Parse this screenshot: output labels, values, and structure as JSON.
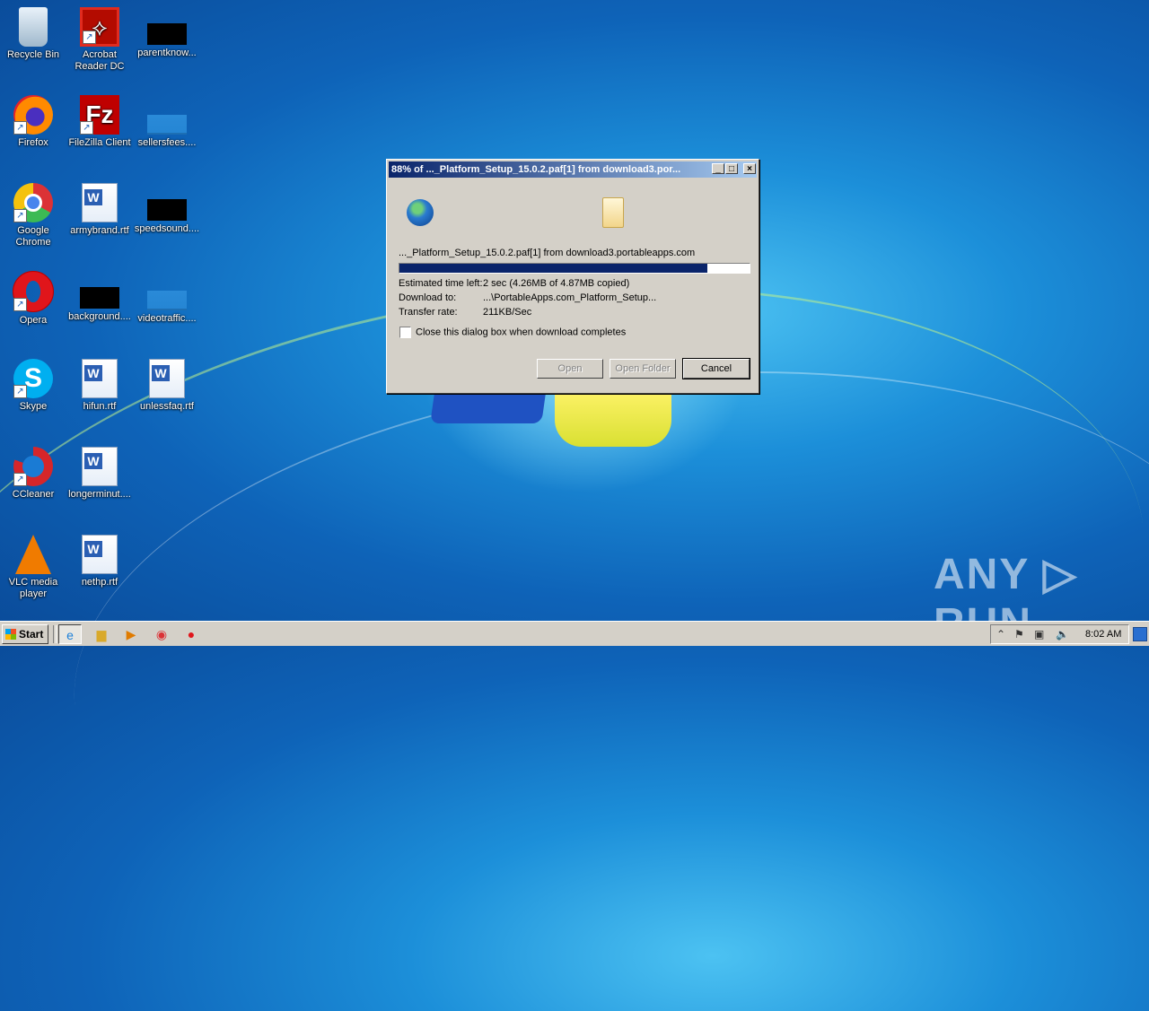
{
  "desktop": {
    "icons": [
      {
        "label": "Recycle Bin",
        "icon": "recycle-bin-icon"
      },
      {
        "label": "Acrobat Reader DC",
        "icon": "acrobat-icon"
      },
      {
        "label": "parentknow...",
        "icon": "blacked-out-icon"
      },
      {
        "label": "Firefox",
        "icon": "firefox-icon"
      },
      {
        "label": "FileZilla Client",
        "icon": "filezilla-icon"
      },
      {
        "label": "sellersfees....",
        "icon": "blank-file-icon"
      },
      {
        "label": "Google Chrome",
        "icon": "chrome-icon"
      },
      {
        "label": "armybrand.rtf",
        "icon": "word-doc-icon"
      },
      {
        "label": "speedsound....",
        "icon": "blacked-out-icon"
      },
      {
        "label": "Opera",
        "icon": "opera-icon"
      },
      {
        "label": "background....",
        "icon": "blacked-out-icon"
      },
      {
        "label": "videotraffic....",
        "icon": "blank-file-icon"
      },
      {
        "label": "Skype",
        "icon": "skype-icon"
      },
      {
        "label": "hifun.rtf",
        "icon": "word-doc-icon"
      },
      {
        "label": "unlessfaq.rtf",
        "icon": "word-doc-icon"
      },
      {
        "label": "CCleaner",
        "icon": "ccleaner-icon"
      },
      {
        "label": "longerminut....",
        "icon": "word-doc-icon"
      },
      {
        "label": "VLC media player",
        "icon": "vlc-icon"
      },
      {
        "label": "nethp.rtf",
        "icon": "word-doc-icon"
      }
    ]
  },
  "dialog": {
    "title": "88% of ..._Platform_Setup_15.0.2.paf[1] from download3.por...",
    "source": "..._Platform_Setup_15.0.2.paf[1] from download3.portableapps.com",
    "progress_percent": 88,
    "estimated_label": "Estimated time left:",
    "estimated_value": "2 sec (4.26MB of 4.87MB copied)",
    "download_to_label": "Download to:",
    "download_to_value": "...\\PortableApps.com_Platform_Setup...",
    "transfer_label": "Transfer rate:",
    "transfer_value": "211KB/Sec",
    "close_checkbox_label": "Close this dialog box when download completes",
    "btn_open": "Open",
    "btn_open_folder": "Open Folder",
    "btn_cancel": "Cancel"
  },
  "taskbar": {
    "start_label": "Start",
    "clock": "8:02 AM"
  },
  "watermark": "ANY ▷ RUN"
}
